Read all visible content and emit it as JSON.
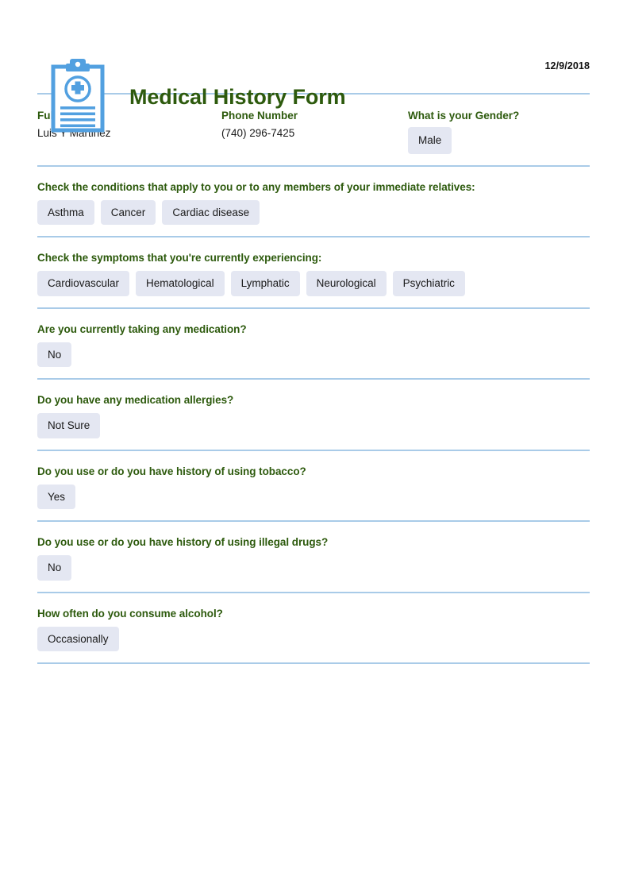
{
  "header": {
    "date": "12/9/2018",
    "title": "Medical History Form",
    "icon": "medical-clipboard-icon"
  },
  "patient": {
    "name_label": "Full Name",
    "name_value": "Luis Y Martinez",
    "phone_label": "Phone Number",
    "phone_value": "(740) 296-7425",
    "gender_label": "What is your Gender?",
    "gender_value": "Male"
  },
  "sections": [
    {
      "key": "conditions",
      "label": "Check the conditions that apply to you or to any members of your immediate relatives:",
      "selected": [
        "Asthma",
        "Cancer",
        "Cardiac disease"
      ]
    },
    {
      "key": "symptoms",
      "label": "Check the symptoms that you're currently experiencing:",
      "selected": [
        "Cardiovascular",
        "Hematological",
        "Lymphatic",
        "Neurological",
        "Psychiatric"
      ]
    },
    {
      "key": "medication",
      "label": "Are you currently taking any medication?",
      "selected": [
        "No"
      ]
    },
    {
      "key": "allergies",
      "label": "Do you have any medication allergies?",
      "selected": [
        "Not Sure"
      ]
    },
    {
      "key": "tobacco",
      "label": "Do you use or do you have history of using tobacco?",
      "selected": [
        "Yes"
      ]
    },
    {
      "key": "drugs",
      "label": "Do you use or do you have history of using illegal drugs?",
      "selected": [
        "No"
      ]
    },
    {
      "key": "alcohol",
      "label": "How often do you consume alcohol?",
      "selected": [
        "Occasionally"
      ]
    }
  ],
  "colors": {
    "heading_green": "#2d5a0d",
    "divider_blue": "#a9cbe8",
    "chip_background": "#e4e7f2",
    "icon_blue": "#52a0e0",
    "body_text": "#1a1a1a"
  }
}
